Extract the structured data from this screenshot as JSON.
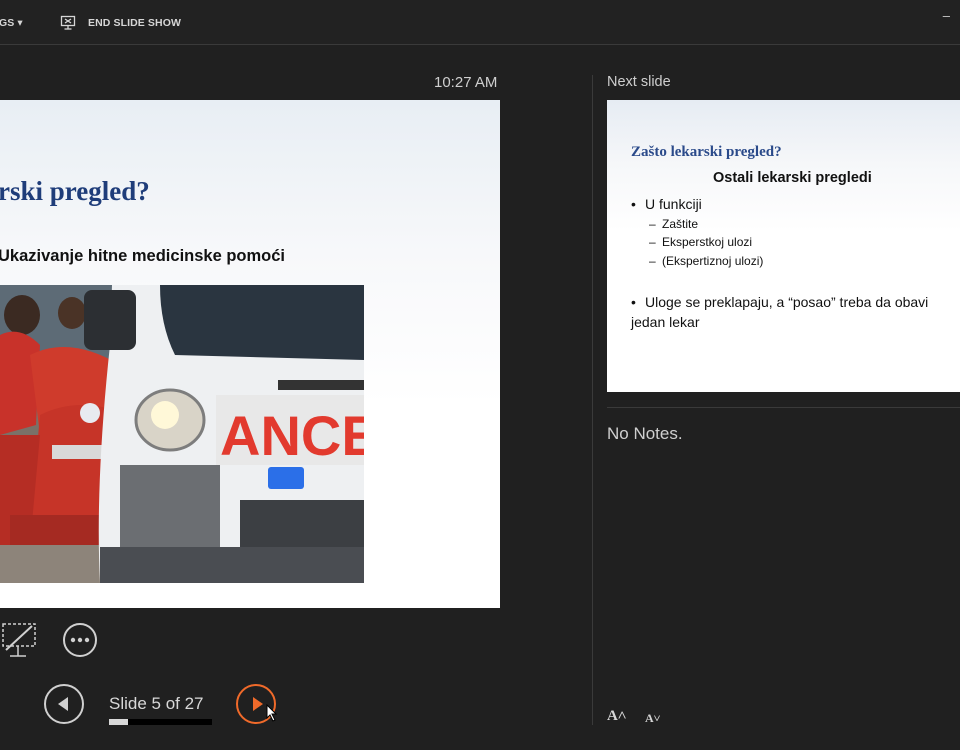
{
  "toolbar": {
    "settings_label": "GS ▾",
    "end_show_label": "END SLIDE SHOW",
    "minimize_glyph": "–"
  },
  "presenter": {
    "clock": "10:27 AM",
    "current_slide": {
      "title": "rski pregled?",
      "subtitle": "Ukazivanje hitne medicinske pomoći",
      "image_text": "ANCE"
    },
    "counter": "Slide 5 of 27",
    "progress_fraction": 0.185
  },
  "next_slide": {
    "label": "Next slide",
    "title": "Zašto lekarski pregled?",
    "subtitle": "Ostali lekarski pregledi",
    "bullet_glyph": "•",
    "dash_glyph": "–",
    "bullet1": "U funkciji",
    "sub_items": [
      "Zaštite",
      "Eksperstkoj ulozi",
      "(Ekspertiznoj  ulozi)"
    ],
    "bullet2": "Uloge se preklapaju, a “posao” treba da obavi jedan lekar"
  },
  "notes": {
    "text": "No Notes.",
    "increase_font_glyph": "A˄",
    "decrease_font_glyph": "A˅"
  },
  "colors": {
    "accent": "#f06a2a",
    "background": "#202020",
    "title_blue": "#1f3d7a"
  },
  "icons": [
    "dropdown-icon",
    "end-slideshow-icon",
    "pen-tool-icon",
    "more-options-icon",
    "previous-icon",
    "next-icon",
    "cursor-icon"
  ]
}
